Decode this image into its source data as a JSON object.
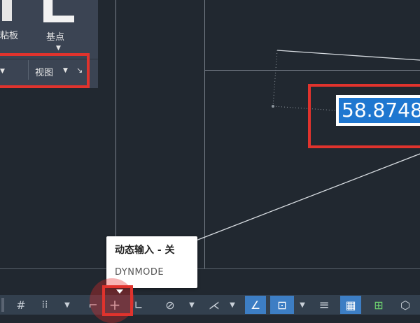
{
  "ribbon": {
    "paste_label": "粘板",
    "basepoint_label": "基点",
    "view_label": "视图",
    "dropdown_glyph": "▼",
    "corner_glyph": "↘"
  },
  "dynamic_input": {
    "value": "58.8748"
  },
  "tooltip": {
    "title": "动态输入 - 关",
    "command": "DYNMODE"
  },
  "statusbar": {
    "items": [
      {
        "name": "grid-icon",
        "glyph": "#"
      },
      {
        "name": "snap-icon",
        "glyph": "⁞⁞"
      },
      {
        "name": "infer-icon",
        "glyph": "⌐"
      },
      {
        "name": "dynamic-input-icon",
        "glyph": "+"
      },
      {
        "name": "ortho-icon",
        "glyph": "∟"
      },
      {
        "name": "polar-icon",
        "glyph": "⊘"
      },
      {
        "name": "isodraft-icon",
        "glyph": "⋌"
      },
      {
        "name": "osnap-tracking-icon",
        "glyph": "∠"
      },
      {
        "name": "osnap-icon",
        "glyph": "⊡"
      },
      {
        "name": "lineweight-icon",
        "glyph": "≡"
      },
      {
        "name": "transparency-icon",
        "glyph": "▦"
      },
      {
        "name": "selection-cycling-icon",
        "glyph": "⊞"
      },
      {
        "name": "3d-osnap-icon",
        "glyph": "⬡"
      }
    ],
    "dropdown_glyph": "▼"
  },
  "colors": {
    "canvas": "#212830",
    "highlight_red": "#e0332d",
    "selection_blue": "#1f77d0",
    "active_toggle": "#3d7ec4"
  }
}
